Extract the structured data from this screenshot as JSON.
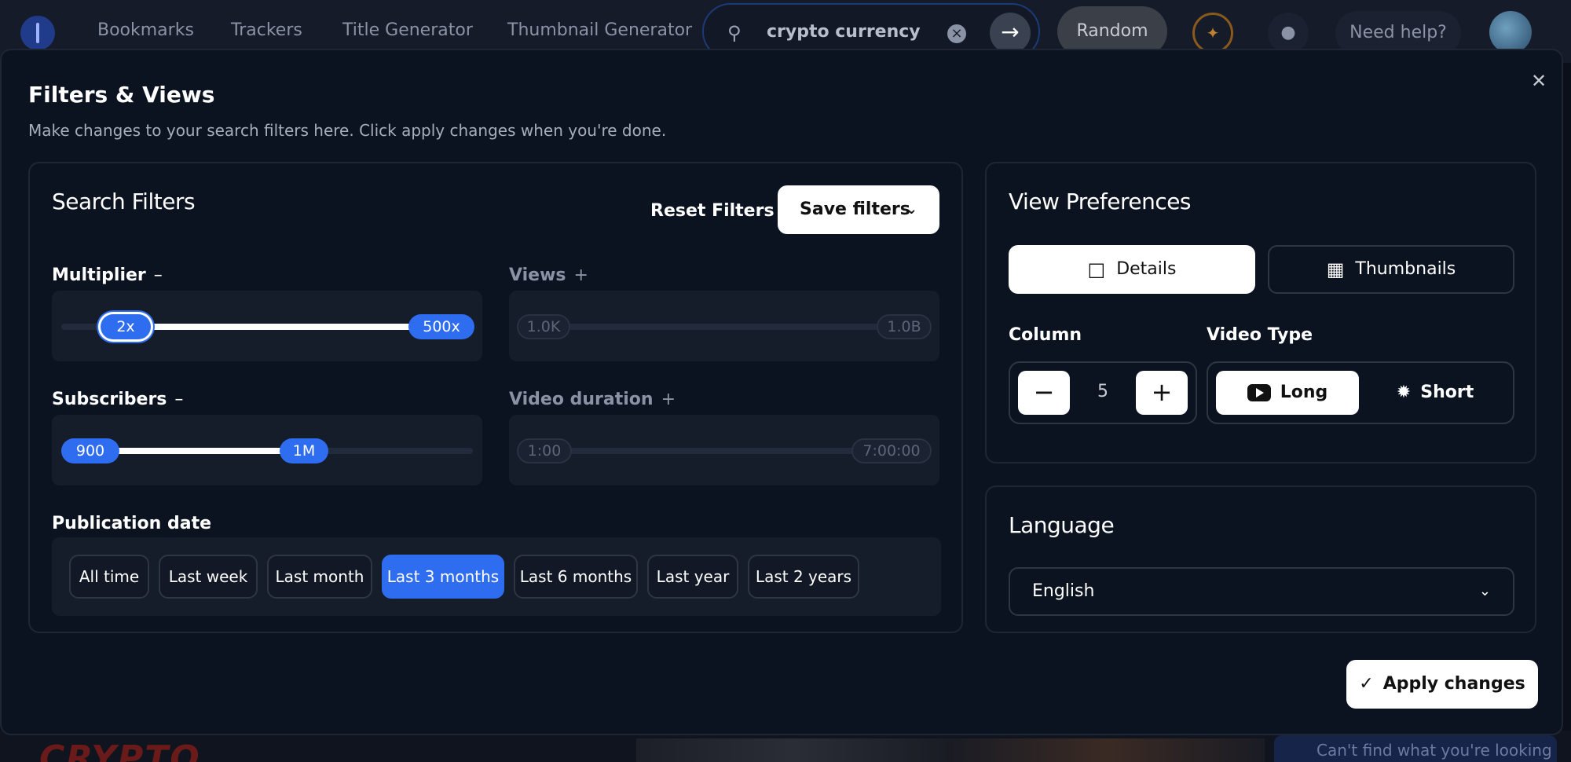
{
  "topbar": {
    "nav": [
      "Bookmarks",
      "Trackers",
      "Title Generator",
      "Thumbnail Generator"
    ],
    "search_value": "crypto currency",
    "random_label": "Random",
    "help_label": "Need help?"
  },
  "background": {
    "crypto_text": "CRYPTO",
    "cant_find": "Can't find what you're looking for?"
  },
  "modal": {
    "title": "Filters & Views",
    "subtitle": "Make changes to your search filters here. Click apply changes when you're done.",
    "apply_label": "Apply changes"
  },
  "search_filters": {
    "title": "Search Filters",
    "reset_label": "Reset Filters",
    "save_label": "Save filters",
    "multiplier": {
      "label": "Multiplier",
      "sign": "–",
      "min": "2x",
      "max": "500x"
    },
    "views": {
      "label": "Views",
      "sign": "+",
      "min": "1.0K",
      "max": "1.0B"
    },
    "subscribers": {
      "label": "Subscribers",
      "sign": "–",
      "min": "900",
      "max": "1M"
    },
    "duration": {
      "label": "Video duration",
      "sign": "+",
      "min": "1:00",
      "max": "7:00:00"
    },
    "publication": {
      "label": "Publication date",
      "options": [
        "All time",
        "Last week",
        "Last month",
        "Last 3 months",
        "Last 6 months",
        "Last year",
        "Last 2 years"
      ],
      "selected": "Last 3 months"
    }
  },
  "view_prefs": {
    "title": "View Preferences",
    "details_label": "Details",
    "thumbnails_label": "Thumbnails",
    "column_label": "Column",
    "column_value": "5",
    "video_type_label": "Video Type",
    "long_label": "Long",
    "short_label": "Short"
  },
  "language": {
    "title": "Language",
    "selected": "English"
  },
  "colors": {
    "accent": "#2f6df0",
    "background": "#0c1320"
  }
}
